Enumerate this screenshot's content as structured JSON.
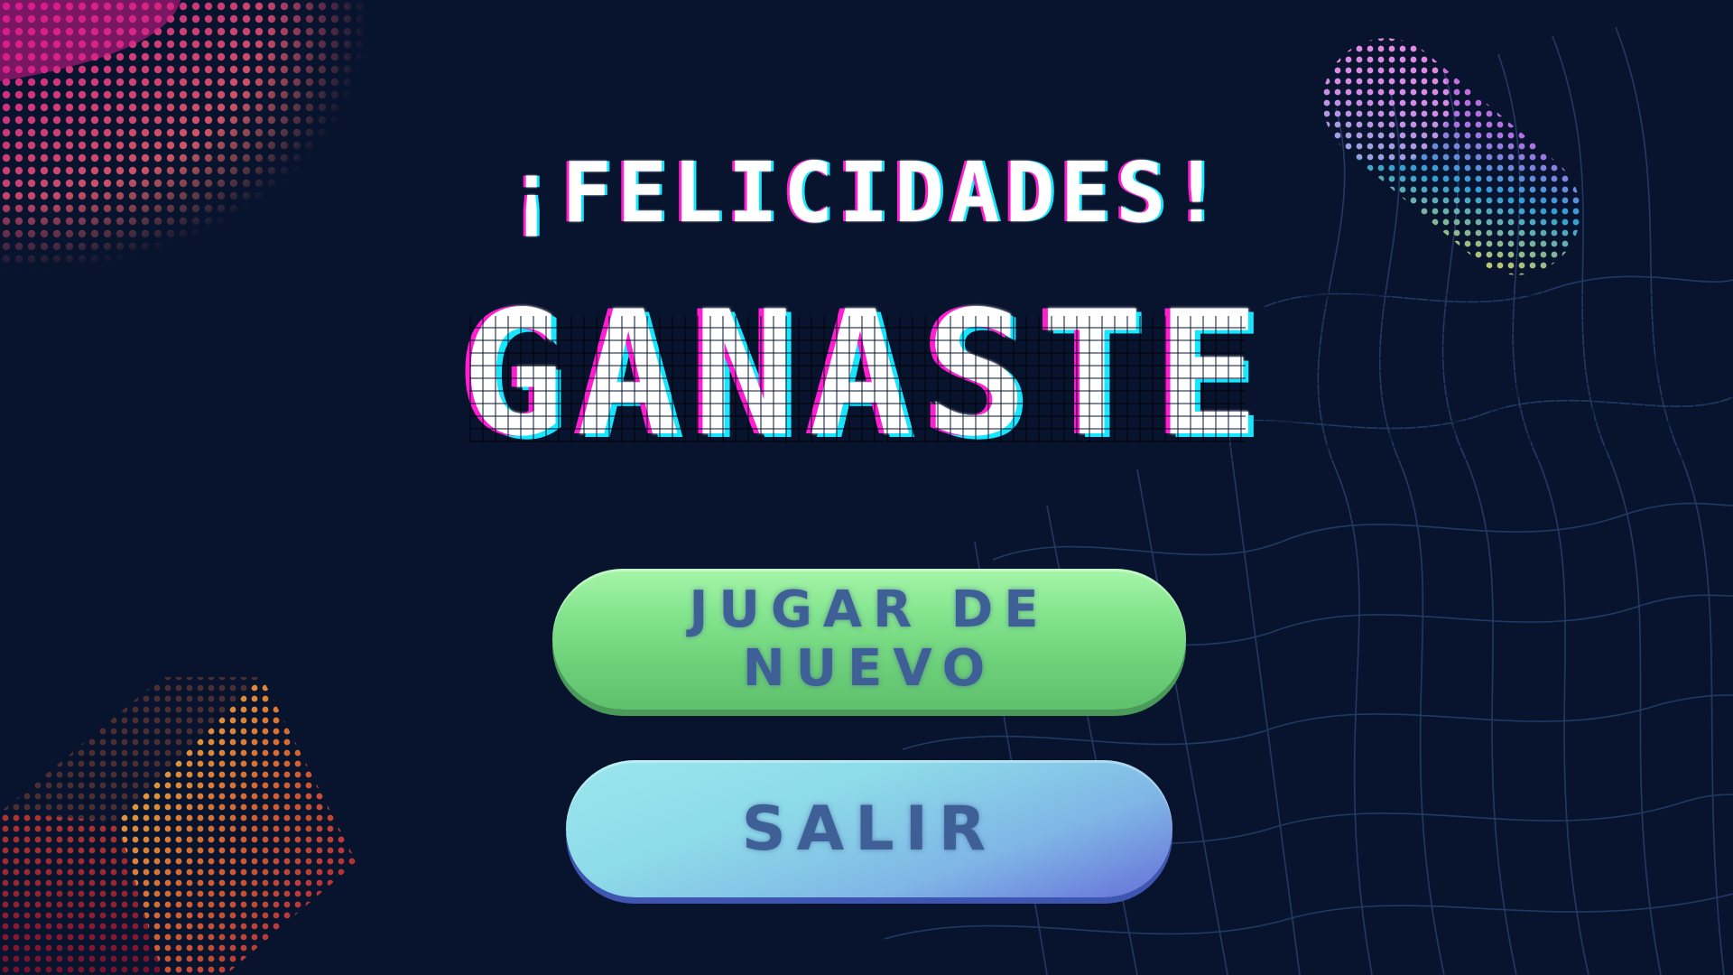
{
  "screen": {
    "heading": "¡FELICIDADES!",
    "result": "GANASTE"
  },
  "buttons": {
    "play_again": "JUGAR DE NUEVO",
    "exit": "SALIR"
  },
  "colors": {
    "background": "#08142e",
    "text_glow_magenta": "#ff1fd0",
    "text_glow_cyan": "#17e6ff",
    "play_button": "#7fdc88",
    "exit_button": "#8ad8ea",
    "button_text": "#3f5f97"
  },
  "decorations": {
    "top_left": "halftone-blob",
    "top_right": "halftone-cylinder",
    "bottom_left": "halftone-cube",
    "bottom_right": "wave-mesh"
  }
}
